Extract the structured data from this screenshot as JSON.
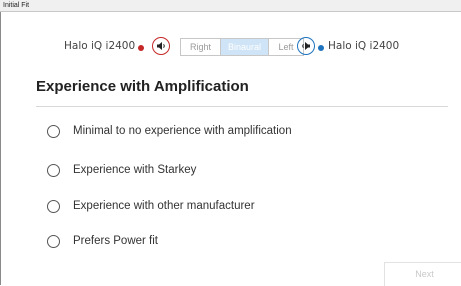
{
  "window": {
    "title": "Initial Fit"
  },
  "devices": {
    "left_name": "Halo iQ i2400",
    "right_name": "Halo iQ i2400",
    "left_color": "#c62828",
    "right_color": "#1e73be",
    "left_icon": "speaker-left-icon",
    "right_icon": "speaker-right-icon"
  },
  "side_selector": {
    "options": [
      "Right",
      "Binaural",
      "Left"
    ],
    "selected": "Binaural"
  },
  "section": {
    "title": "Experience with Amplification"
  },
  "options": [
    {
      "label": "Minimal to no experience with amplification"
    },
    {
      "label": "Experience with Starkey"
    },
    {
      "label": "Experience with other manufacturer"
    },
    {
      "label": "Prefers Power fit"
    }
  ],
  "footer": {
    "next_label": "Next"
  }
}
